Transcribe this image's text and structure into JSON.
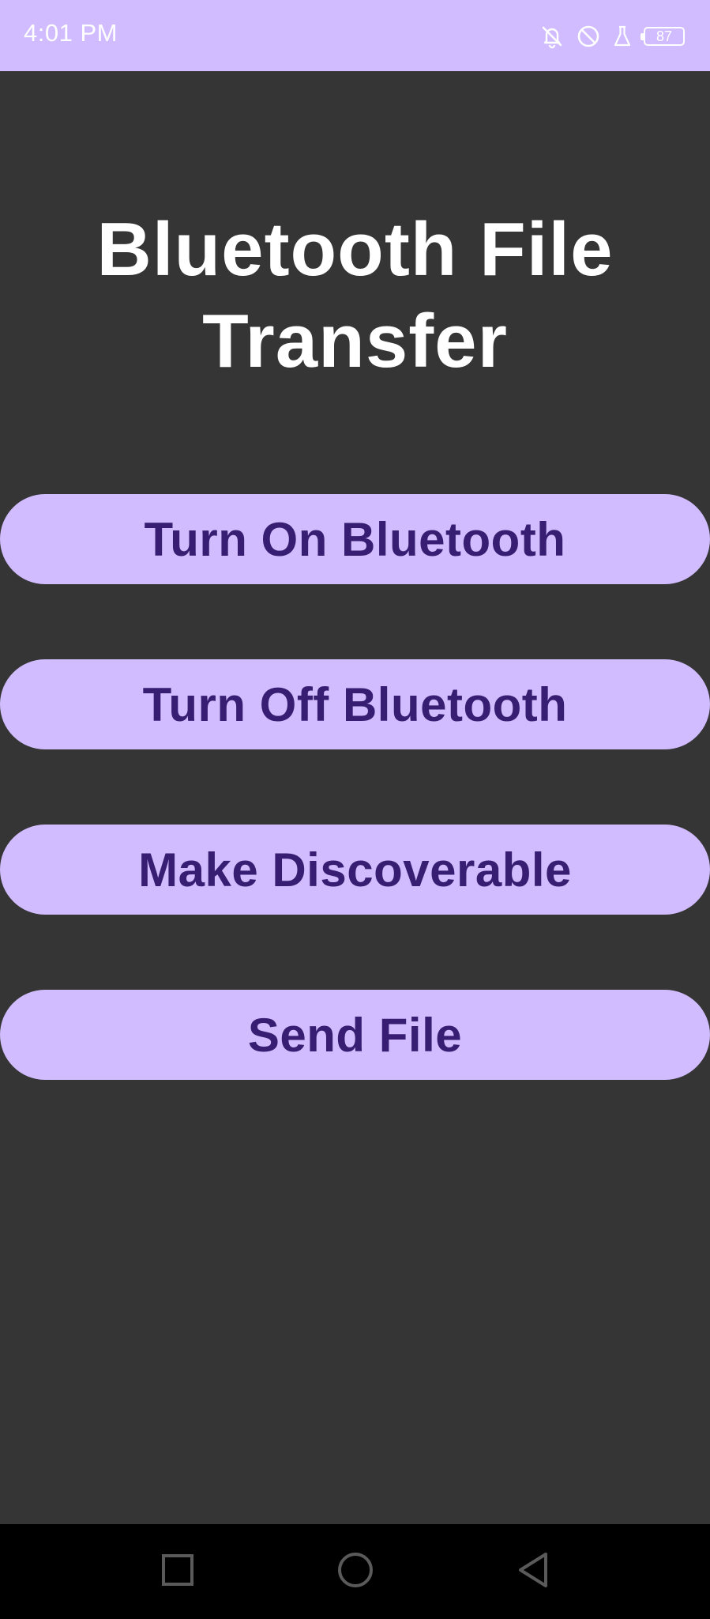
{
  "status_bar": {
    "time": "4:01 PM",
    "battery": "87",
    "icons": [
      "notifications-off-icon",
      "do-not-disturb-icon",
      "lab-flask-icon",
      "battery-icon"
    ]
  },
  "main": {
    "title": "Bluetooth File Transfer",
    "buttons": [
      {
        "label": "Turn On Bluetooth"
      },
      {
        "label": "Turn Off Bluetooth"
      },
      {
        "label": "Make Discoverable"
      },
      {
        "label": "Send File"
      }
    ]
  },
  "nav_bar": {
    "icons": [
      "recents-square-icon",
      "home-circle-icon",
      "back-triangle-icon"
    ]
  },
  "colors": {
    "accent": "#d0bcfe",
    "button_text": "#381e72",
    "background": "#353535",
    "nav_bar": "#000000"
  }
}
